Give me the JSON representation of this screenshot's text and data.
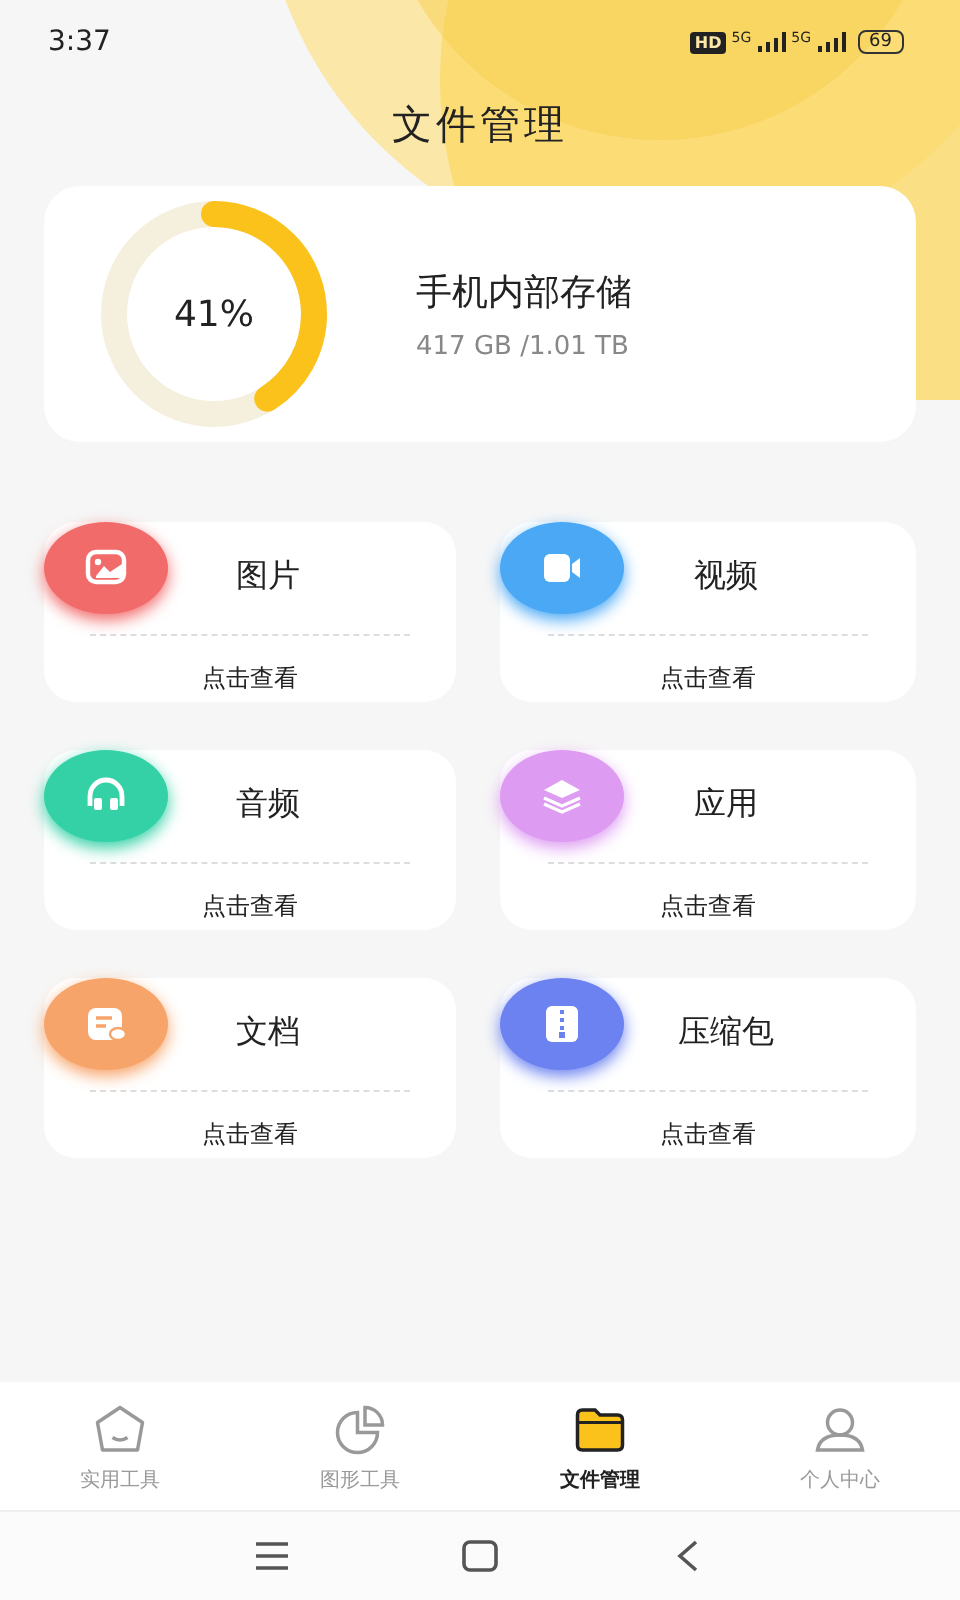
{
  "status_bar": {
    "time": "3:37",
    "hd": "HD",
    "networks": [
      "5G",
      "5G"
    ],
    "battery": "69"
  },
  "title": "文件管理",
  "storage": {
    "percent": "41%",
    "level": 0.41,
    "name": "手机内部存储",
    "usage": "417 GB /1.01 TB"
  },
  "categories": [
    {
      "kind": "image",
      "label": "图片",
      "action": "点击查看",
      "color": "#f26b6b"
    },
    {
      "kind": "video",
      "label": "视频",
      "action": "点击查看",
      "color": "#4aa8f5"
    },
    {
      "kind": "audio",
      "label": "音频",
      "action": "点击查看",
      "color": "#34d1a6"
    },
    {
      "kind": "app",
      "label": "应用",
      "action": "点击查看",
      "color": "#dd9cf2"
    },
    {
      "kind": "doc",
      "label": "文档",
      "action": "点击查看",
      "color": "#f7a46a"
    },
    {
      "kind": "zip",
      "label": "压缩包",
      "action": "点击查看",
      "color": "#6b82f0"
    }
  ],
  "tabs": [
    {
      "kind": "tools",
      "label": "实用工具",
      "selected": false
    },
    {
      "kind": "chart",
      "label": "图形工具",
      "selected": false
    },
    {
      "kind": "folder",
      "label": "文件管理",
      "selected": true
    },
    {
      "kind": "person",
      "label": "个人中心",
      "selected": false
    }
  ]
}
